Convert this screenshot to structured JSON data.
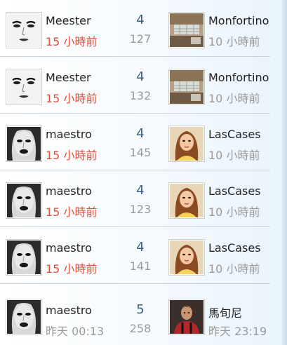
{
  "rows": [
    {
      "left_user": {
        "name": "Meester",
        "time": "15 小時前",
        "avatar": "face-sketch-avatar"
      },
      "replies": "4",
      "views": "127",
      "right_user": {
        "name": "Monfortino",
        "time": "10 小時前",
        "avatar": "interior-photo-avatar"
      }
    },
    {
      "left_user": {
        "name": "Meester",
        "time": "15 小時前",
        "avatar": "face-sketch-avatar"
      },
      "replies": "4",
      "views": "132",
      "right_user": {
        "name": "Monfortino",
        "time": "10 小時前",
        "avatar": "interior-photo-avatar"
      }
    },
    {
      "left_user": {
        "name": "maestro",
        "time": "15 小時前",
        "avatar": "bw-portrait-avatar"
      },
      "replies": "4",
      "views": "145",
      "right_user": {
        "name": "LasCases",
        "time": "10 小時前",
        "avatar": "girl-photo-avatar"
      }
    },
    {
      "left_user": {
        "name": "maestro",
        "time": "15 小時前",
        "avatar": "bw-portrait-avatar"
      },
      "replies": "4",
      "views": "123",
      "right_user": {
        "name": "LasCases",
        "time": "10 小時前",
        "avatar": "girl-photo-avatar"
      }
    },
    {
      "left_user": {
        "name": "maestro",
        "time": "15 小時前",
        "avatar": "bw-portrait-avatar"
      },
      "replies": "4",
      "views": "141",
      "right_user": {
        "name": "LasCases",
        "time": "10 小時前",
        "avatar": "girl-photo-avatar"
      }
    },
    {
      "left_user": {
        "name": "maestro",
        "time": "昨天 00:13",
        "avatar": "bw-portrait-avatar"
      },
      "replies": "5",
      "views": "258",
      "right_user": {
        "name": "馬旬尼",
        "time": "昨天 23:19",
        "avatar": "footballer-photo-avatar"
      }
    }
  ],
  "colors": {
    "recent_time": "#e0503a",
    "old_time": "#9a9a9a",
    "reply_count": "#365f86",
    "divider": "#c9d2da"
  }
}
